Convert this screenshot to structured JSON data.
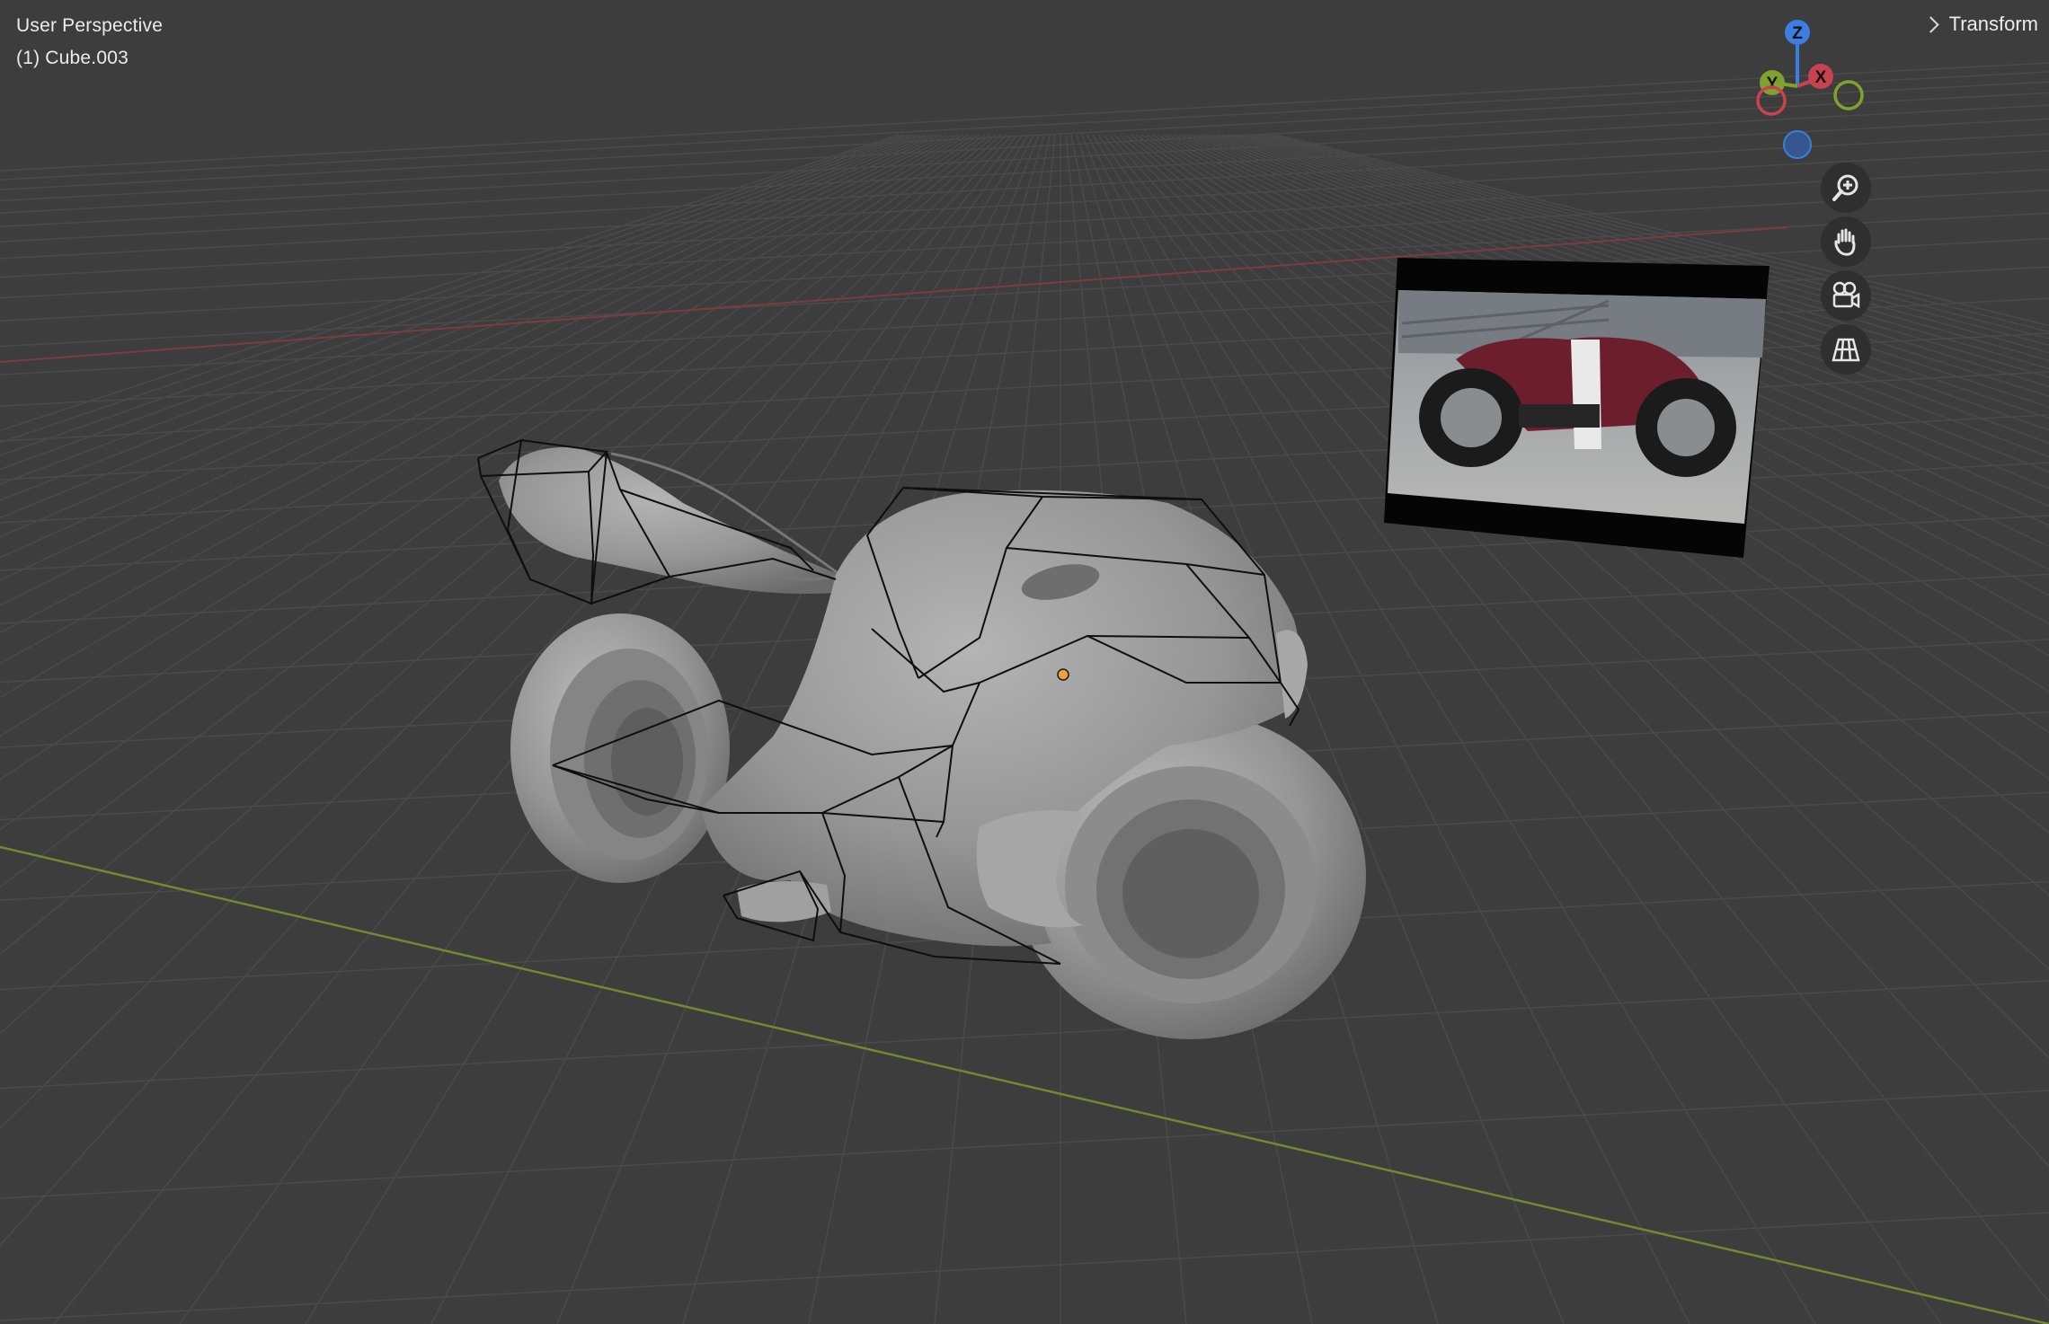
{
  "viewport": {
    "view_label": "User Perspective",
    "object_label": "(1) Cube.003"
  },
  "sidebar_tab": {
    "label": "Transform"
  },
  "gizmo": {
    "axes": [
      {
        "name": "Z",
        "color": "#3b7de0"
      },
      {
        "name": "X",
        "color": "#c8434f"
      },
      {
        "name": "Y",
        "color": "#7fa22f"
      }
    ]
  },
  "navigation": [
    {
      "id": "zoom",
      "icon": "zoom-icon"
    },
    {
      "id": "pan",
      "icon": "hand-icon"
    },
    {
      "id": "camera",
      "icon": "camera-icon"
    },
    {
      "id": "ortho",
      "icon": "grid-icon"
    }
  ],
  "colors": {
    "background": "#3d3d3d",
    "grid": "#4a4a4a",
    "x_axis": "#7a3c3c",
    "y_axis": "#6f8a33",
    "mesh": "#8e8e8e",
    "cage": "#0e0e0e",
    "origin": "#f0a040"
  }
}
